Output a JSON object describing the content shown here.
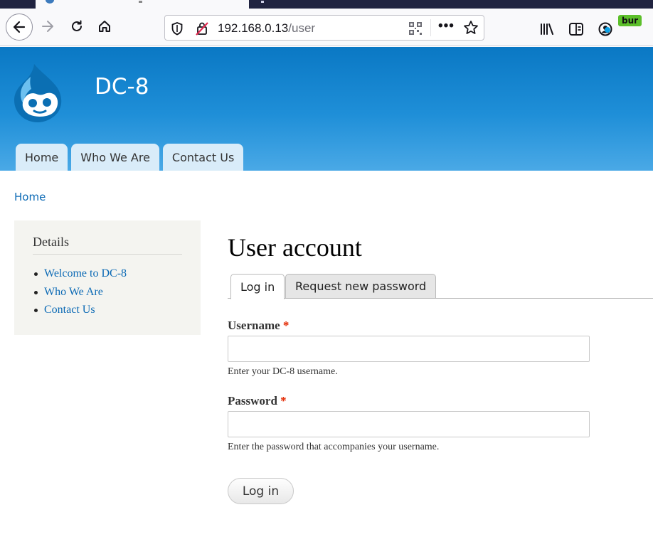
{
  "browser": {
    "url_host": "192.168.0.13",
    "url_path": "/user",
    "extension_badge": "bur"
  },
  "site": {
    "name": "DC-8"
  },
  "primary_nav": [
    {
      "label": "Home"
    },
    {
      "label": "Who We Are"
    },
    {
      "label": "Contact Us"
    }
  ],
  "breadcrumb": "Home",
  "sidebar": {
    "title": "Details",
    "items": [
      {
        "label": "Welcome to DC-8"
      },
      {
        "label": "Who We Are"
      },
      {
        "label": "Contact Us"
      }
    ]
  },
  "page": {
    "title": "User account",
    "tabs": [
      {
        "label": "Log in"
      },
      {
        "label": "Request new password"
      }
    ]
  },
  "form": {
    "username_label": "Username",
    "username_value": "",
    "username_desc": "Enter your DC-8 username.",
    "password_label": "Password",
    "password_value": "",
    "password_desc": "Enter the password that accompanies your username.",
    "required_mark": "*",
    "submit_label": "Log in"
  },
  "colors": {
    "header_top": "#0a78c4",
    "header_bottom": "#4aa9e6",
    "link": "#0c6ab5",
    "required": "#e32700"
  }
}
